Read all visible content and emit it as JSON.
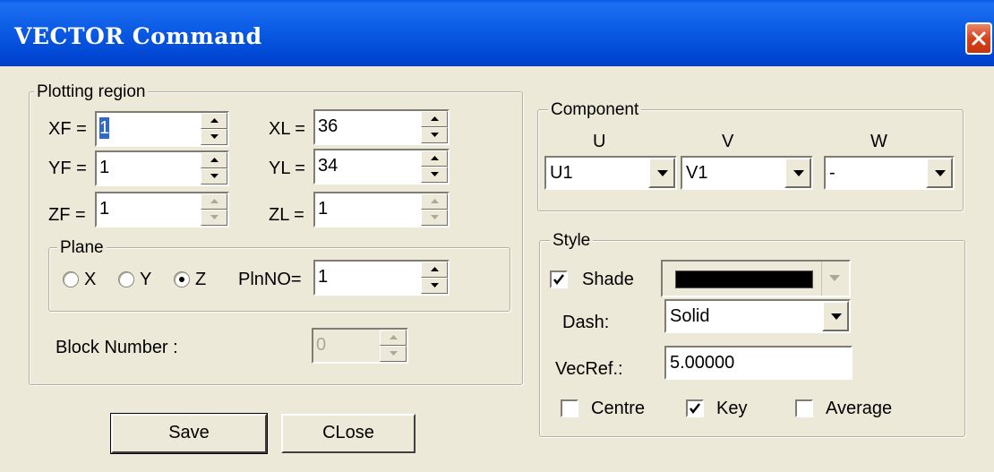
{
  "window": {
    "title": "VECTOR Command"
  },
  "plotting_region": {
    "label": "Plotting region",
    "fields": [
      {
        "key": "xf",
        "label": "XF =",
        "value": "1"
      },
      {
        "key": "yf",
        "label": "YF =",
        "value": "1"
      },
      {
        "key": "zf",
        "label": "ZF =",
        "value": "1"
      },
      {
        "key": "xl",
        "label": "XL =",
        "value": "36"
      },
      {
        "key": "yl",
        "label": "YL =",
        "value": "34"
      },
      {
        "key": "zl",
        "label": "ZL =",
        "value": "1"
      }
    ],
    "plane": {
      "label": "Plane",
      "options": [
        "X",
        "Y",
        "Z"
      ],
      "selected": "Z",
      "plnno_label": "PlnNO=",
      "plnno_value": "1"
    },
    "block_number": {
      "label": "Block Number :",
      "value": "0"
    }
  },
  "component": {
    "label": "Component",
    "columns": [
      {
        "header": "U",
        "value": "U1"
      },
      {
        "header": "V",
        "value": "V1"
      },
      {
        "header": "W",
        "value": "-"
      }
    ]
  },
  "style": {
    "label": "Style",
    "shade_label": "Shade",
    "shade_checked": true,
    "shade_color": "#000000",
    "dash_label": "Dash:",
    "dash_value": "Solid",
    "vecref_label": "VecRef.:",
    "vecref_value": "5.00000",
    "centre_label": "Centre",
    "centre_checked": false,
    "key_label": "Key",
    "key_checked": true,
    "average_label": "Average",
    "average_checked": false
  },
  "buttons": {
    "save": "Save",
    "close": "CLose"
  }
}
